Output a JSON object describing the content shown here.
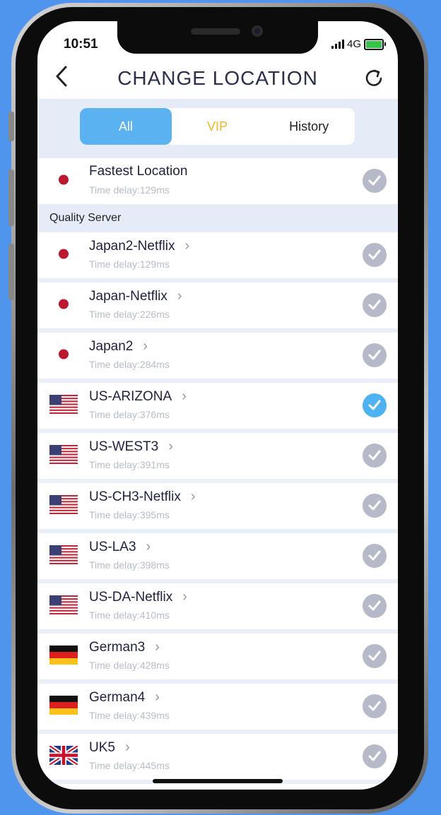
{
  "status": {
    "time": "10:51",
    "network": "4G"
  },
  "header": {
    "title": "CHANGE LOCATION",
    "back_icon": "chevron-left-icon",
    "refresh_icon": "refresh-icon"
  },
  "tabs": [
    {
      "label": "All",
      "active": true
    },
    {
      "label": "VIP",
      "active": false,
      "color": "#f0b62a"
    },
    {
      "label": "History",
      "active": false
    }
  ],
  "fastest": {
    "name": "Fastest Location",
    "delay": "Time delay:129ms",
    "flag": "japan"
  },
  "section_title": "Quality Server",
  "servers": [
    {
      "name": "Japan2-Netflix",
      "delay": "Time delay:129ms",
      "flag": "japan",
      "selected": false
    },
    {
      "name": "Japan-Netflix",
      "delay": "Time delay:226ms",
      "flag": "japan",
      "selected": false
    },
    {
      "name": "Japan2",
      "delay": "Time delay:284ms",
      "flag": "japan",
      "selected": false
    },
    {
      "name": "US-ARIZONA",
      "delay": "Time delay:376ms",
      "flag": "usa",
      "selected": true
    },
    {
      "name": "US-WEST3",
      "delay": "Time delay:391ms",
      "flag": "usa",
      "selected": false
    },
    {
      "name": "US-CH3-Netflix",
      "delay": "Time delay:395ms",
      "flag": "usa",
      "selected": false
    },
    {
      "name": "US-LA3",
      "delay": "Time delay:398ms",
      "flag": "usa",
      "selected": false
    },
    {
      "name": "US-DA-Netflix",
      "delay": "Time delay:410ms",
      "flag": "usa",
      "selected": false
    },
    {
      "name": "German3",
      "delay": "Time delay:428ms",
      "flag": "germany",
      "selected": false
    },
    {
      "name": "German4",
      "delay": "Time delay:439ms",
      "flag": "germany",
      "selected": false
    },
    {
      "name": "UK5",
      "delay": "Time delay:445ms",
      "flag": "uk",
      "selected": false
    }
  ],
  "colors": {
    "accent": "#5ab2f0",
    "selected_check": "#4fb2f2",
    "unselected_check": "#b6b9c8",
    "background": "#4f95ee"
  }
}
